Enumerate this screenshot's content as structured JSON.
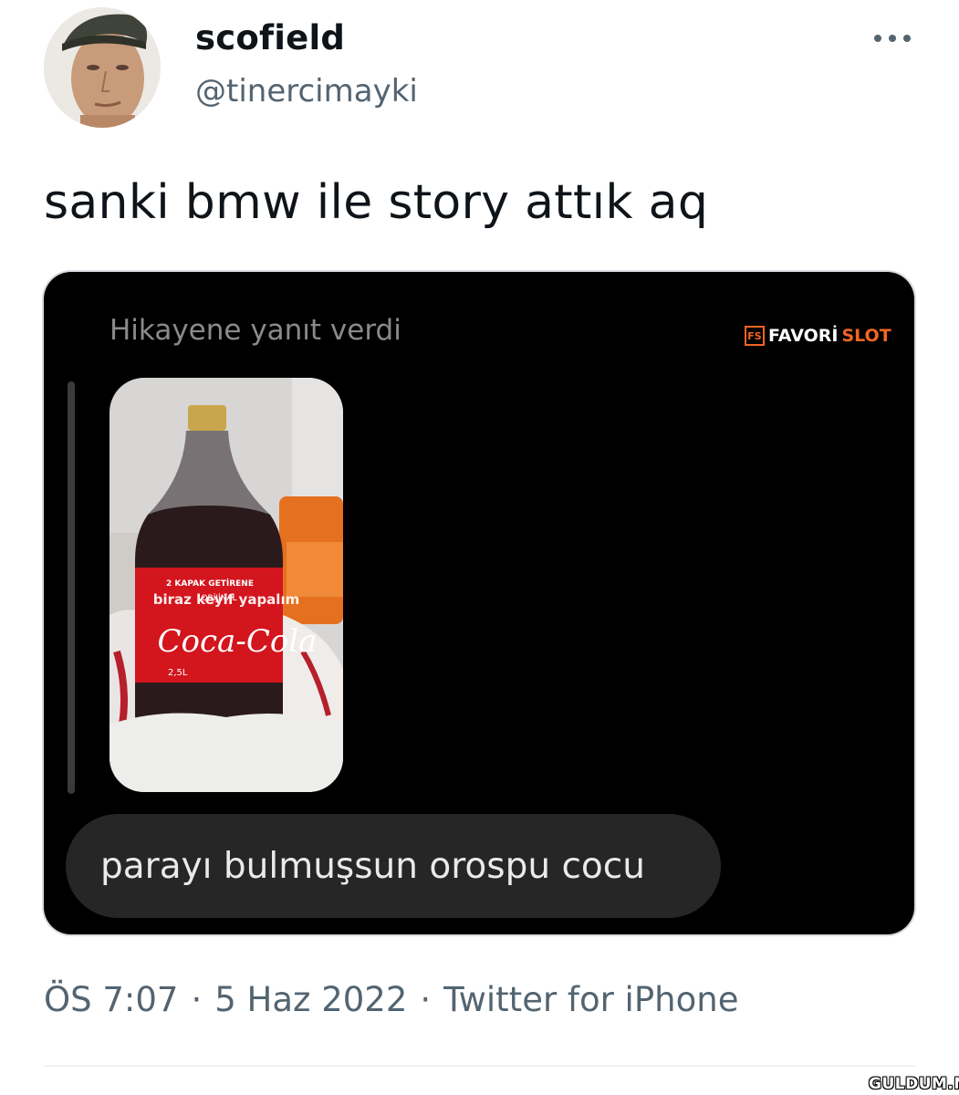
{
  "tweet": {
    "author": {
      "display_name": "scofield",
      "handle": "@tinercimayki",
      "avatar_icon": "user-avatar-photo"
    },
    "more_icon": "more-horizontal-icon",
    "text": "sanki bmw ile story attık aq",
    "media": {
      "reply_context": "Hikayene yanıt verdi",
      "watermark": {
        "word_a": "FAVORİ",
        "word_b": "SLOT",
        "badge": "FS"
      },
      "story_caption": "biraz keyif yapalım",
      "story_image": "coca-cola-bottle-photo",
      "message": "parayı bulmuşsun orospu cocu"
    },
    "meta": {
      "time": "ÖS 7:07",
      "date": "5 Haz 2022",
      "separator": "·",
      "source": "Twitter for iPhone"
    }
  },
  "site_watermark": "GULDUM.NET",
  "colors": {
    "text_primary": "#0f1419",
    "text_secondary": "#536471",
    "media_bg": "#000000",
    "bubble_bg": "#262626",
    "brand_orange": "#f26522",
    "coke_red": "#d3151d"
  }
}
